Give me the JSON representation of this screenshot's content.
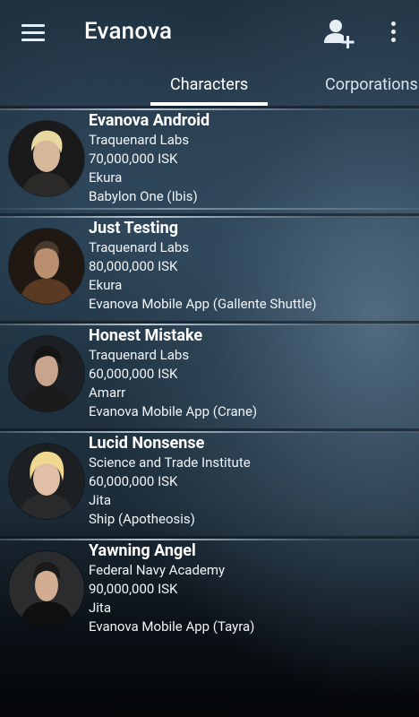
{
  "app": {
    "title": "Evanova"
  },
  "tabs": [
    {
      "label": "Characters",
      "active": true
    },
    {
      "label": "Corporations",
      "active": false
    }
  ],
  "icons": {
    "menu": "hamburger-menu-icon",
    "add_account": "add-person-icon",
    "more": "more-vertical-icon"
  },
  "characters": [
    {
      "name": "Evanova Android",
      "corporation": "Traquenard Labs",
      "balance": "70,000,000 ISK",
      "location": "Ekura",
      "ship": "Babylon One (Ibis)"
    },
    {
      "name": "Just Testing",
      "corporation": "Traquenard Labs",
      "balance": "80,000,000 ISK",
      "location": "Ekura",
      "ship": "Evanova Mobile App (Gallente Shuttle)"
    },
    {
      "name": "Honest Mistake",
      "corporation": "Traquenard Labs",
      "balance": "60,000,000 ISK",
      "location": "Amarr",
      "ship": "Evanova Mobile App (Crane)"
    },
    {
      "name": "Lucid Nonsense",
      "corporation": "Science and Trade Institute",
      "balance": "60,000,000 ISK",
      "location": "Jita",
      "ship": "Ship (Apotheosis)"
    },
    {
      "name": "Yawning Angel",
      "corporation": "Federal Navy Academy",
      "balance": "90,000,000 ISK",
      "location": "Jita",
      "ship": "Evanova Mobile App (Tayra)"
    }
  ]
}
